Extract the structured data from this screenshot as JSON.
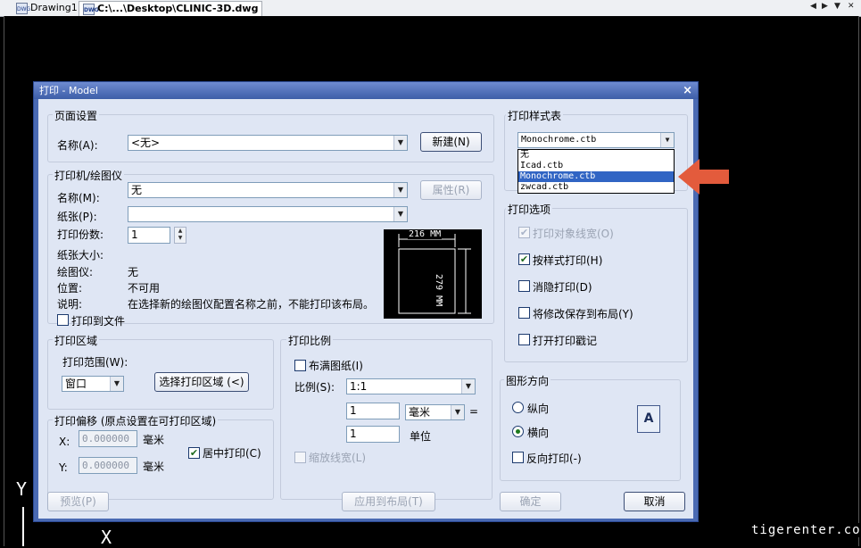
{
  "tabs": [
    {
      "label": "Drawing1",
      "icon": "dwg-file-icon"
    },
    {
      "label": "C:\\...\\Desktop\\CLINIC-3D.dwg",
      "icon": "dwg-file-icon"
    }
  ],
  "tab_icon_text": "DWG",
  "nav": {
    "prev": "◀",
    "next": "▶",
    "menu": "▼",
    "close": "✕"
  },
  "ucs": {
    "y": "Y",
    "x": "X"
  },
  "watermark": "tigerenter.co",
  "dialog": {
    "title": "打印 - Model",
    "close_icon": "×",
    "page_setup": {
      "title": "页面设置",
      "name_label": "名称(A):",
      "name_value": "<无>",
      "new_button": "新建(N)"
    },
    "printer": {
      "title": "打印机/绘图仪",
      "name_label": "名称(M):",
      "name_value": "无",
      "properties_button": "属性(R)",
      "paper_label": "纸张(P):",
      "paper_value": "",
      "copies_label": "打印份数:",
      "copies_value": "1",
      "paper_size_label": "纸张大小:",
      "plotter_label": "绘图仪:",
      "plotter_value": "无",
      "location_label": "位置:",
      "location_value": "不可用",
      "description_label": "说明:",
      "description_value": "在选择新的绘图仪配置名称之前，不能打印该布局。",
      "print_to_file_label": "打印到文件",
      "preview_width": "216 MM",
      "preview_height": "279 MM"
    },
    "plot_area": {
      "title": "打印区域",
      "range_label": "打印范围(W):",
      "range_value": "窗口",
      "select_button": "选择打印区域 (<)"
    },
    "plot_offset": {
      "title": "打印偏移 (原点设置在可打印区域)",
      "x_label": "X:",
      "x_value": "0.000000",
      "y_label": "Y:",
      "y_value": "0.000000",
      "unit": "毫米",
      "center_label": "居中打印(C)",
      "center_checked": true
    },
    "plot_scale": {
      "title": "打印比例",
      "fit_label": "布满图纸(I)",
      "scale_label": "比例(S):",
      "scale_value": "1:1",
      "value1": "1",
      "unit_value": "毫米",
      "equals": "=",
      "value2": "1",
      "unit_label": "单位",
      "lineweight_label": "缩放线宽(L)"
    },
    "style_table": {
      "title": "打印样式表",
      "selected": "Monochrome.ctb",
      "options": [
        "无",
        "Icad.ctb",
        "Monochrome.ctb",
        "zwcad.ctb"
      ],
      "highlighted_index": 2
    },
    "plot_options": {
      "title": "打印选项",
      "items": [
        {
          "label": "打印对象线宽(O)",
          "checked": true,
          "disabled": true
        },
        {
          "label": "按样式打印(H)",
          "checked": true,
          "disabled": false
        },
        {
          "label": "消隐打印(D)",
          "checked": false,
          "disabled": false
        },
        {
          "label": "将修改保存到布局(Y)",
          "checked": false,
          "disabled": false
        },
        {
          "label": "打开打印戳记",
          "checked": false,
          "disabled": false
        }
      ]
    },
    "orientation": {
      "title": "图形方向",
      "portrait": "纵向",
      "landscape": "横向",
      "selected": "landscape",
      "reverse": "反向打印(-)",
      "icon_letter": "A"
    },
    "buttons": {
      "preview": "预览(P)",
      "apply": "应用到布局(T)",
      "ok": "确定",
      "cancel": "取消"
    }
  },
  "colors": {
    "dialog_bg": "#dfe6f4",
    "title_bar": "#4a6ab3",
    "highlight": "#3165c4",
    "arrow": "#e35b3c"
  }
}
